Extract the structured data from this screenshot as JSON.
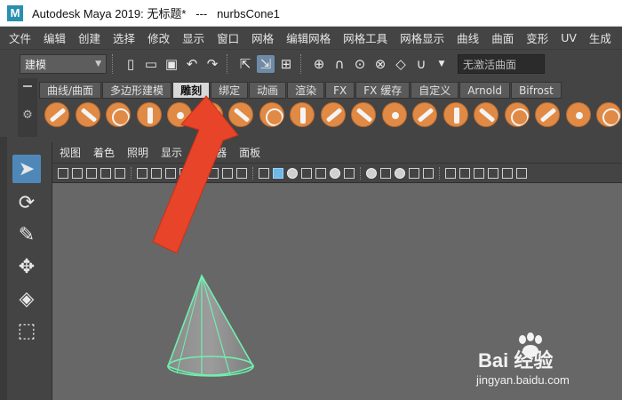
{
  "window": {
    "logo_letter": "M",
    "title": "Autodesk Maya 2019: 无标题*   ---   nurbsCone1"
  },
  "menubar": {
    "items": [
      "文件",
      "编辑",
      "创建",
      "选择",
      "修改",
      "显示",
      "窗口",
      "网格",
      "编辑网格",
      "网格工具",
      "网格显示",
      "曲线",
      "曲面",
      "变形",
      "UV",
      "生成"
    ]
  },
  "statusline": {
    "mode": "建模",
    "live_surface": "无激活曲面"
  },
  "shelf": {
    "tabs": [
      "曲线/曲面",
      "多边形建模",
      "雕刻",
      "绑定",
      "动画",
      "渲染",
      "FX",
      "FX 缓存",
      "自定义",
      "Arnold",
      "Bifrost"
    ],
    "active_tab": "雕刻",
    "icon_count": 19
  },
  "panel": {
    "menu": [
      "视图",
      "着色",
      "照明",
      "显示",
      "渲染器",
      "面板"
    ]
  },
  "watermark": {
    "brand": "Bai 经验",
    "url": "jingyan.baidu.com"
  },
  "colors": {
    "accent_orange": "#e08a45",
    "annotation_arrow": "#e8442a",
    "cone_wire": "#6ff0b0",
    "active_blue": "#4f88b8"
  }
}
